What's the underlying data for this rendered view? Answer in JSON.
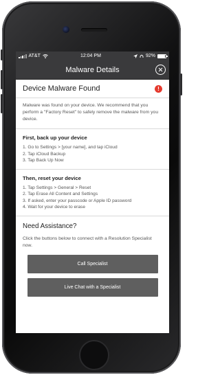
{
  "status_bar": {
    "carrier": "AT&T",
    "time": "12:04 PM",
    "battery": "92%"
  },
  "nav": {
    "title": "Malware Details"
  },
  "alert": {
    "title": "Device Malware Found",
    "icon": "alert-icon",
    "color": "#e53a2e"
  },
  "intro": "Malware was found on your device. We recommend that you perform a \"Factory Reset\" to safely remove the malware from you device.",
  "backup": {
    "heading": "First, back up your device",
    "steps": [
      "1. Go to Settings > [your name], and tap iCloud",
      "2. Tap iCloud Backup",
      "3. Tap Back Up Now"
    ]
  },
  "reset": {
    "heading": "Then, reset your device",
    "steps": [
      "1. Tap Settings > General > Reset",
      "2. Tap Erase All Content and Settings",
      "3. If asked, enter your passcode or Apple ID password",
      "4. Wait for your device to erase"
    ]
  },
  "assistance": {
    "heading": "Need Assistance?",
    "text": "Click the buttons below to connect with a Resolution Specialist now.",
    "call_label": "Call Specialist",
    "chat_label": "Live Chat with a Specialist"
  },
  "colors": {
    "nav_bg": "#3a3a3c",
    "button_bg": "#5f5f5f"
  }
}
